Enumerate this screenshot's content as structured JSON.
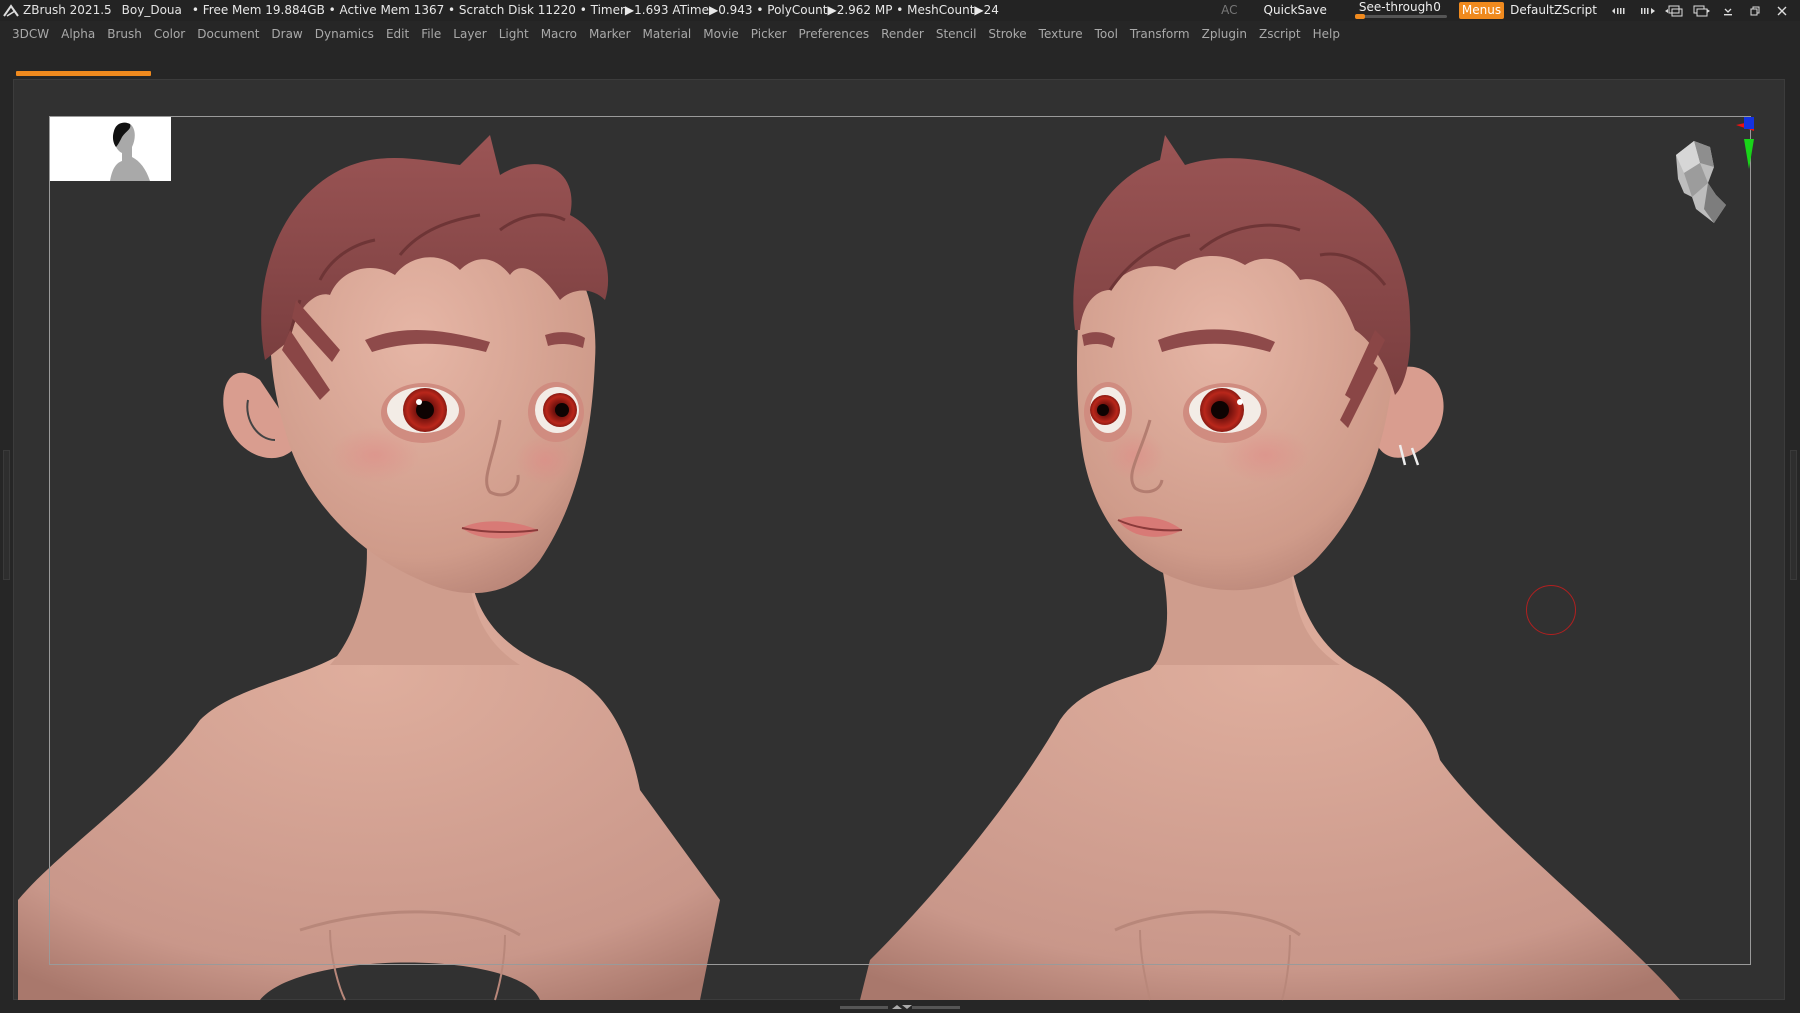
{
  "app": {
    "name": "ZBrush 2021.5",
    "project": "Boy_Doua",
    "stats": "• Free Mem 19.884GB • Active Mem 1367 • Scratch Disk 11220 • Timer▶1.693 ATime▶0.943 • PolyCount▶2.962 MP • MeshCount▶24"
  },
  "titlebar_right": {
    "ac": "AC",
    "quicksave": "QuickSave",
    "see_through_label": "See-through",
    "see_through_value": "0",
    "menus": "Menus",
    "script": "DefaultZScript"
  },
  "menu": [
    "3DCW",
    "Alpha",
    "Brush",
    "Color",
    "Document",
    "Draw",
    "Dynamics",
    "Edit",
    "File",
    "Layer",
    "Light",
    "Macro",
    "Marker",
    "Material",
    "Movie",
    "Picker",
    "Preferences",
    "Render",
    "Stencil",
    "Stroke",
    "Texture",
    "Tool",
    "Transform",
    "Zplugin",
    "Zscript",
    "Help"
  ],
  "colors": {
    "accent": "#f08a1e",
    "background": "#313131",
    "skin": "#d9a493",
    "hair": "#8e4a4a",
    "eye": "#b11a14"
  },
  "icons": [
    "zbrush-logo-icon",
    "layout-left-icon",
    "layout-right-icon",
    "window-arrange-icon",
    "window-swap-icon",
    "minimize-icon",
    "restore-icon",
    "close-icon",
    "navigation-head-icon",
    "axis-gizmo-icon"
  ]
}
